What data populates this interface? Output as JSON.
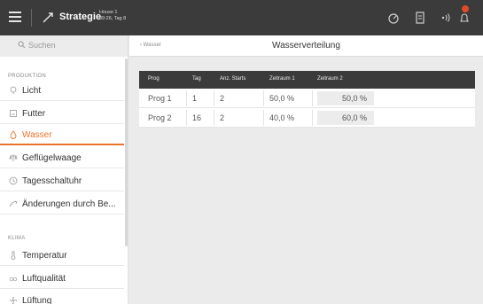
{
  "header": {
    "title": "Strategie",
    "house_line1": "House 1",
    "house_line2": "09:26, Tag 8"
  },
  "sidebar": {
    "search_placeholder": "Suchen",
    "sections": [
      {
        "label": "PRODUKTION"
      },
      {
        "label": "KLIMA"
      }
    ],
    "items": [
      {
        "label": "Licht",
        "icon": "bulb-icon"
      },
      {
        "label": "Futter",
        "icon": "feeder-icon"
      },
      {
        "label": "Wasser",
        "icon": "water-drop-icon",
        "active": true
      },
      {
        "label": "Geflügelwaage",
        "icon": "scale-icon"
      },
      {
        "label": "Tagesschaltuhr",
        "icon": "clock-icon"
      },
      {
        "label": "Änderungen durch Be...",
        "icon": "change-icon"
      },
      {
        "label": "Temperatur",
        "icon": "thermometer-icon"
      },
      {
        "label": "Luftqualität",
        "icon": "co2-icon"
      },
      {
        "label": "Lüftung",
        "icon": "fan-icon"
      }
    ]
  },
  "page": {
    "back_label": "Wasser",
    "title": "Wasserverteilung"
  },
  "table": {
    "columns": [
      "Prog",
      "Tag",
      "Anz. Starts",
      "Zeitraum 1",
      "Zeitraum 2"
    ],
    "rows": [
      [
        "Prog 1",
        "1",
        "2",
        "50,0 %",
        "50,0 %"
      ],
      [
        "Prog 2",
        "16",
        "2",
        "40,0 %",
        "60,0 %"
      ]
    ]
  },
  "colors": {
    "accent": "#e8742c",
    "topbar": "#3b3b3b",
    "badge": "#e04a2a"
  }
}
